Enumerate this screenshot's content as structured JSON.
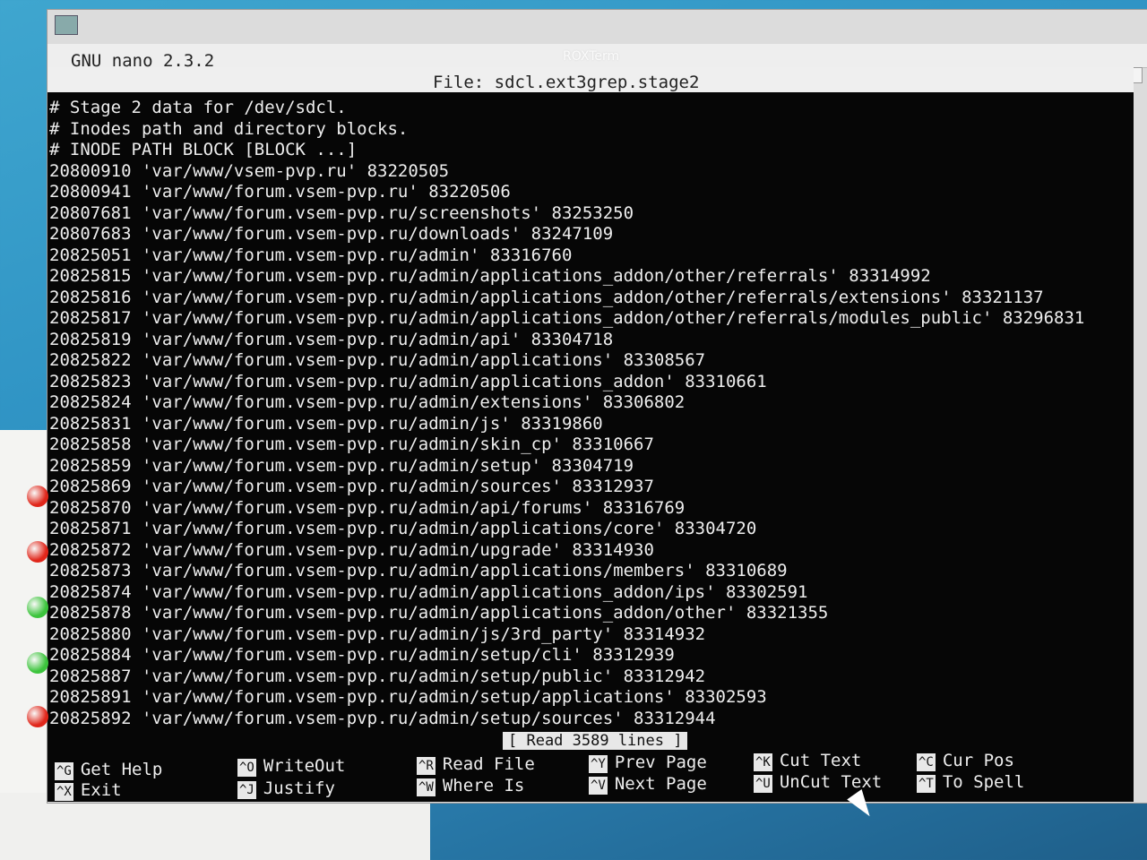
{
  "window": {
    "wm_title": "ROXTerm"
  },
  "nano": {
    "version": "GNU nano 2.3.2",
    "file_label": "File: sdcl.ext3grep.stage2",
    "lines": [
      "# Stage 2 data for /dev/sdcl.",
      "# Inodes path and directory blocks.",
      "# INODE PATH BLOCK [BLOCK ...]",
      "20800910 'var/www/vsem-pvp.ru' 83220505",
      "20800941 'var/www/forum.vsem-pvp.ru' 83220506",
      "20807681 'var/www/forum.vsem-pvp.ru/screenshots' 83253250",
      "20807683 'var/www/forum.vsem-pvp.ru/downloads' 83247109",
      "20825051 'var/www/forum.vsem-pvp.ru/admin' 83316760",
      "20825815 'var/www/forum.vsem-pvp.ru/admin/applications_addon/other/referrals' 83314992",
      "20825816 'var/www/forum.vsem-pvp.ru/admin/applications_addon/other/referrals/extensions' 83321137",
      "20825817 'var/www/forum.vsem-pvp.ru/admin/applications_addon/other/referrals/modules_public' 83296831",
      "20825819 'var/www/forum.vsem-pvp.ru/admin/api' 83304718",
      "20825822 'var/www/forum.vsem-pvp.ru/admin/applications' 83308567",
      "20825823 'var/www/forum.vsem-pvp.ru/admin/applications_addon' 83310661",
      "20825824 'var/www/forum.vsem-pvp.ru/admin/extensions' 83306802",
      "20825831 'var/www/forum.vsem-pvp.ru/admin/js' 83319860",
      "20825858 'var/www/forum.vsem-pvp.ru/admin/skin_cp' 83310667",
      "20825859 'var/www/forum.vsem-pvp.ru/admin/setup' 83304719",
      "20825869 'var/www/forum.vsem-pvp.ru/admin/sources' 83312937",
      "20825870 'var/www/forum.vsem-pvp.ru/admin/api/forums' 83316769",
      "20825871 'var/www/forum.vsem-pvp.ru/admin/applications/core' 83304720",
      "20825872 'var/www/forum.vsem-pvp.ru/admin/upgrade' 83314930",
      "20825873 'var/www/forum.vsem-pvp.ru/admin/applications/members' 83310689",
      "20825874 'var/www/forum.vsem-pvp.ru/admin/applications_addon/ips' 83302591",
      "20825878 'var/www/forum.vsem-pvp.ru/admin/applications_addon/other' 83321355",
      "20825880 'var/www/forum.vsem-pvp.ru/admin/js/3rd_party' 83314932",
      "20825884 'var/www/forum.vsem-pvp.ru/admin/setup/cli' 83312939",
      "20825887 'var/www/forum.vsem-pvp.ru/admin/setup/public' 83312942",
      "20825891 'var/www/forum.vsem-pvp.ru/admin/setup/applications' 83302593",
      "20825892 'var/www/forum.vsem-pvp.ru/admin/setup/sources' 83312944"
    ],
    "status": "[ Read 3589 lines ]",
    "shortcuts": [
      {
        "key": "^G",
        "label": "Get Help"
      },
      {
        "key": "^O",
        "label": "WriteOut"
      },
      {
        "key": "^R",
        "label": "Read File"
      },
      {
        "key": "^Y",
        "label": "Prev Page"
      },
      {
        "key": "^K",
        "label": "Cut Text"
      },
      {
        "key": "^C",
        "label": "Cur Pos"
      },
      {
        "key": "^X",
        "label": "Exit"
      },
      {
        "key": "^J",
        "label": "Justify"
      },
      {
        "key": "^W",
        "label": "Where Is"
      },
      {
        "key": "^V",
        "label": "Next Page"
      },
      {
        "key": "^U",
        "label": "UnCut Text"
      },
      {
        "key": "^T",
        "label": "To Spell"
      }
    ]
  },
  "leds": [
    "#e0261a",
    "#e0261a",
    "#3cc43c",
    "#3cc43c",
    "#e0261a"
  ]
}
